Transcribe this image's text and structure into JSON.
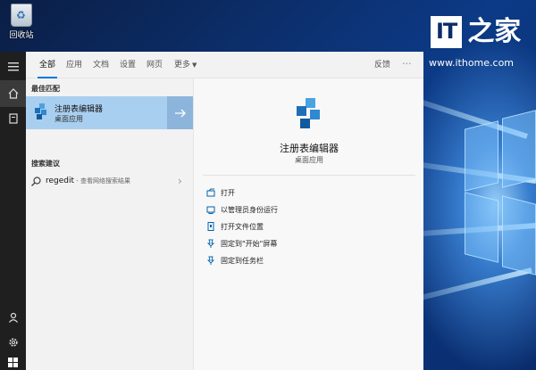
{
  "desktop": {
    "recycle_bin_label": "回收站",
    "watermark_logo_it": "IT",
    "watermark_logo_zh": "之家",
    "watermark_url": "www.ithome.com"
  },
  "rail": {
    "icons": [
      "hamburger-icon",
      "home-icon",
      "document-icon",
      "user-icon",
      "gear-icon",
      "windows-logo-icon"
    ]
  },
  "tabs": [
    {
      "label": "全部",
      "active": true
    },
    {
      "label": "应用"
    },
    {
      "label": "文档"
    },
    {
      "label": "设置"
    },
    {
      "label": "网页"
    },
    {
      "label": "更多"
    }
  ],
  "header": {
    "feedback_label": "反馈",
    "more_label": "···"
  },
  "best_match": {
    "heading": "最佳匹配",
    "title": "注册表编辑器",
    "subtitle": "桌面应用"
  },
  "suggestions": {
    "heading": "搜索建议",
    "query": "regedit",
    "description": " - 查看网络搜索结果"
  },
  "detail": {
    "title": "注册表编辑器",
    "subtitle": "桌面应用",
    "actions": [
      {
        "label": "打开",
        "icon": "open-icon"
      },
      {
        "label": "以管理员身份运行",
        "icon": "run-as-admin-icon"
      },
      {
        "label": "打开文件位置",
        "icon": "file-location-icon"
      },
      {
        "label": "固定到\"开始\"屏幕",
        "icon": "pin-start-icon"
      },
      {
        "label": "固定到任务栏",
        "icon": "pin-taskbar-icon"
      }
    ]
  },
  "colors": {
    "accent": "#0078d7",
    "selection": "#a9cff0",
    "rail": "#1f1f1f"
  }
}
